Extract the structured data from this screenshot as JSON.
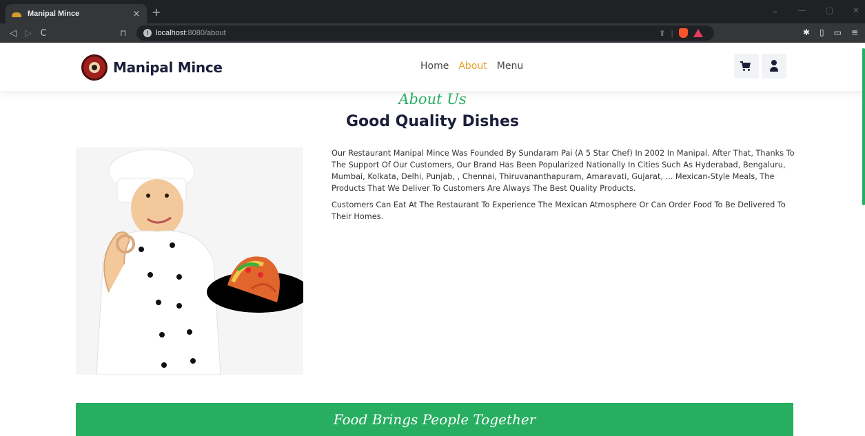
{
  "browser": {
    "tab_title": "Manipal Mince",
    "tab_close": "×",
    "new_tab": "+",
    "url_host": "localhost",
    "url_rest": ":8080/about",
    "back": "◁",
    "forward": "▷",
    "reload": "C"
  },
  "header": {
    "brand": "Manipal Mince",
    "nav": [
      {
        "label": "Home"
      },
      {
        "label": "About"
      },
      {
        "label": "Menu"
      }
    ]
  },
  "about": {
    "eyebrow": "About Us",
    "heading": "Good Quality Dishes",
    "paragraphs": [
      "Our Restaurant Manipal Mince Was Founded By Sundaram Pai (A 5 Star Chef) In 2002 In Manipal. After That, Thanks To The Support Of Our Customers, Our Brand Has Been Popularized Nationally In Cities Such As Hyderabad, Bengaluru, Mumbai, Kolkata, Delhi, Punjab, , Chennai, Thiruvananthapuram, Amaravati, Gujarat, ... Mexican-Style Meals, The Products That We Deliver To Customers Are Always The Best Quality Products.",
      "Customers Can Eat At The Restaurant To Experience The Mexican Atmosphere Or Can Order Food To Be Delivered To Their Homes."
    ]
  },
  "banner": {
    "text": "Food Brings People Together"
  },
  "colors": {
    "accent_green": "#27ae60",
    "nav_active": "#e6a12b",
    "brand_dark": "#1b1f3a"
  },
  "icons": {
    "cart": "cart-icon",
    "user": "user-icon"
  }
}
